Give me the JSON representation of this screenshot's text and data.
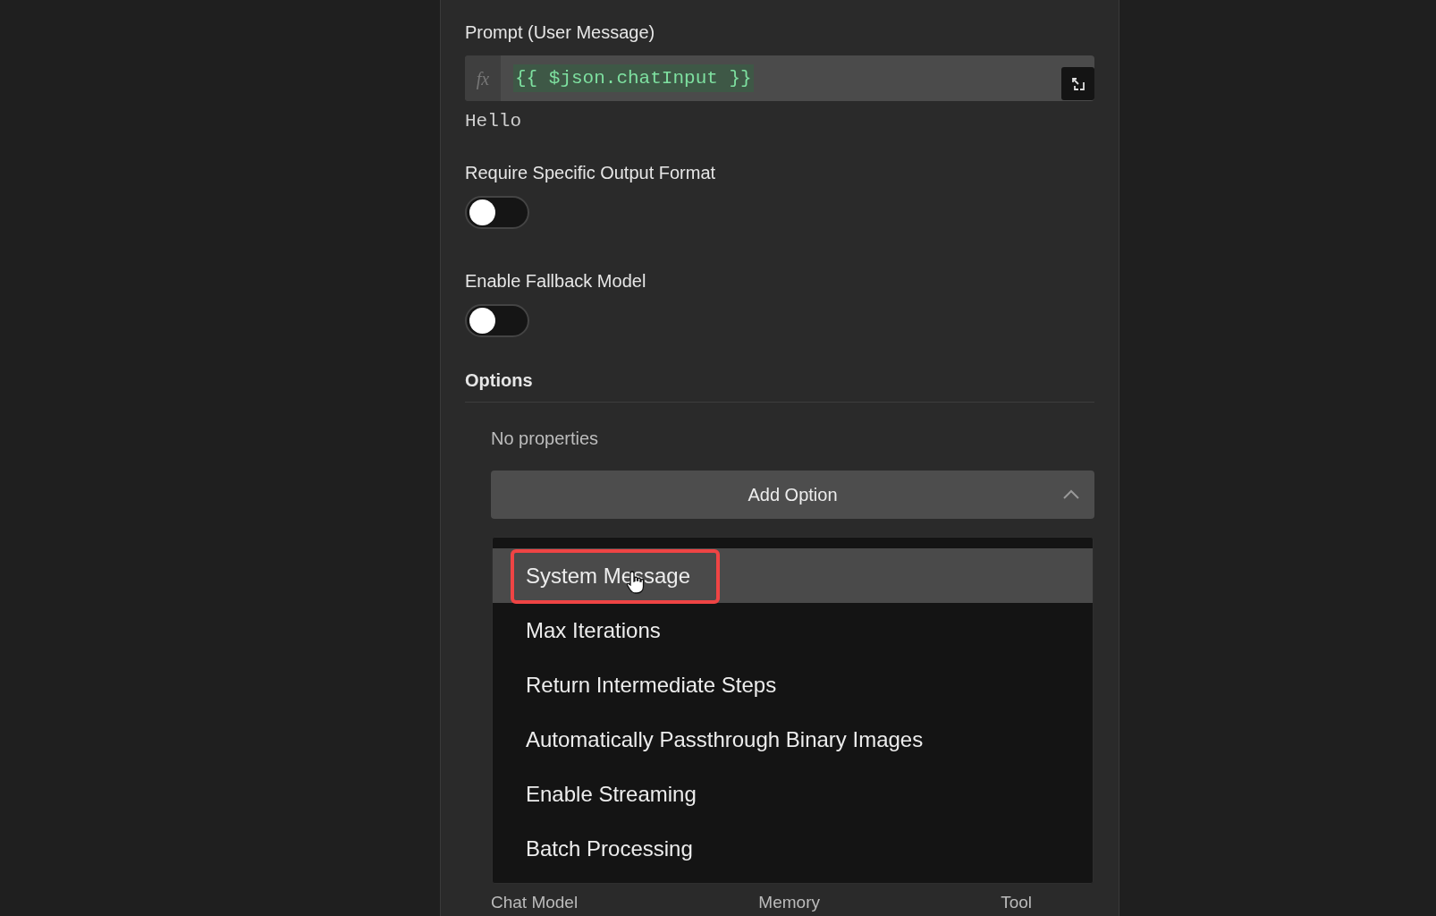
{
  "prompt": {
    "label": "Prompt (User Message)",
    "fx": "fx",
    "expression": "{{ $json.chatInput }}",
    "result": "Hello"
  },
  "toggles": [
    {
      "label": "Require Specific Output Format",
      "on": false
    },
    {
      "label": "Enable Fallback Model",
      "on": false
    }
  ],
  "options": {
    "title": "Options",
    "empty_text": "No properties",
    "add_button": "Add Option",
    "expanded": true
  },
  "menu": [
    {
      "label": "System Message",
      "selected": true
    },
    {
      "label": "Max Iterations",
      "selected": false
    },
    {
      "label": "Return Intermediate Steps",
      "selected": false
    },
    {
      "label": "Automatically Passthrough Binary Images",
      "selected": false
    },
    {
      "label": "Enable Streaming",
      "selected": false
    },
    {
      "label": "Batch Processing",
      "selected": false
    }
  ],
  "connectors": [
    "Chat Model",
    "Memory",
    "Tool"
  ]
}
